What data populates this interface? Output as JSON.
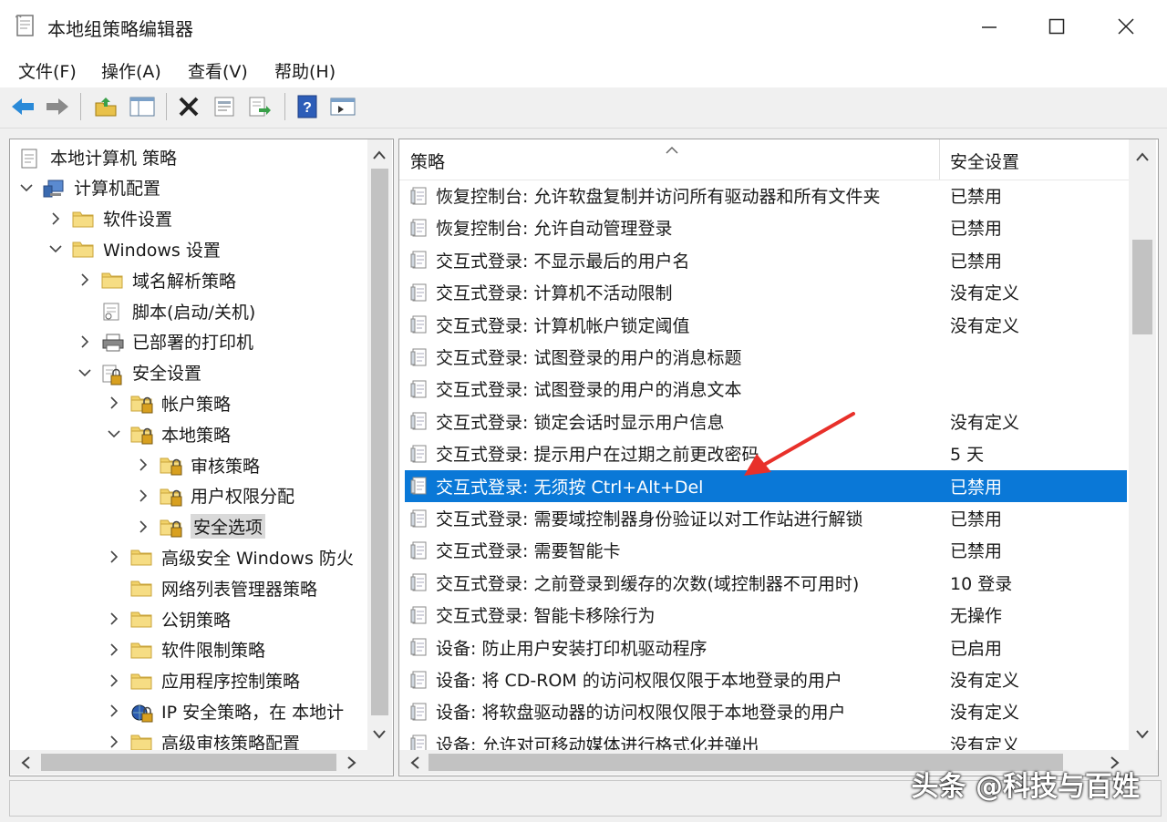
{
  "window": {
    "title": "本地组策略编辑器"
  },
  "menu": [
    "文件(F)",
    "操作(A)",
    "查看(V)",
    "帮助(H)"
  ],
  "tree": [
    {
      "label": "本地计算机 策略",
      "level": 0,
      "expand": "none",
      "icon": "policy-icon"
    },
    {
      "label": "计算机配置",
      "level": 0,
      "expand": "open",
      "icon": "computer-icon"
    },
    {
      "label": "软件设置",
      "level": 1,
      "expand": "closed",
      "icon": "folder-icon"
    },
    {
      "label": "Windows 设置",
      "level": 1,
      "expand": "open",
      "icon": "folder-icon"
    },
    {
      "label": "域名解析策略",
      "level": 2,
      "expand": "closed",
      "icon": "folder-icon"
    },
    {
      "label": "脚本(启动/关机)",
      "level": 2,
      "expand": "none",
      "icon": "script-icon"
    },
    {
      "label": "已部署的打印机",
      "level": 2,
      "expand": "closed",
      "icon": "printer-icon"
    },
    {
      "label": "安全设置",
      "level": 2,
      "expand": "open",
      "icon": "security-icon"
    },
    {
      "label": "帐户策略",
      "level": 3,
      "expand": "closed",
      "icon": "lock-folder-icon"
    },
    {
      "label": "本地策略",
      "level": 3,
      "expand": "open",
      "icon": "lock-folder-icon"
    },
    {
      "label": "审核策略",
      "level": 4,
      "expand": "closed",
      "icon": "lock-folder-icon"
    },
    {
      "label": "用户权限分配",
      "level": 4,
      "expand": "closed",
      "icon": "lock-folder-icon"
    },
    {
      "label": "安全选项",
      "level": 4,
      "expand": "closed",
      "icon": "lock-folder-icon",
      "selected": true
    },
    {
      "label": "高级安全 Windows 防火",
      "level": 3,
      "expand": "closed",
      "icon": "folder-icon"
    },
    {
      "label": "网络列表管理器策略",
      "level": 3,
      "expand": "none",
      "icon": "folder-icon"
    },
    {
      "label": "公钥策略",
      "level": 3,
      "expand": "closed",
      "icon": "folder-icon"
    },
    {
      "label": "软件限制策略",
      "level": 3,
      "expand": "closed",
      "icon": "folder-icon"
    },
    {
      "label": "应用程序控制策略",
      "level": 3,
      "expand": "closed",
      "icon": "folder-icon"
    },
    {
      "label": "IP 安全策略，在 本地计",
      "level": 3,
      "expand": "closed",
      "icon": "ip-security-icon"
    },
    {
      "label": "高级审核策略配置",
      "level": 3,
      "expand": "closed",
      "icon": "folder-icon"
    }
  ],
  "list": {
    "col_policy": "策略",
    "col_setting": "安全设置",
    "rows": [
      {
        "name": "恢复控制台: 允许软盘复制并访问所有驱动器和所有文件夹",
        "value": "已禁用"
      },
      {
        "name": "恢复控制台: 允许自动管理登录",
        "value": "已禁用"
      },
      {
        "name": "交互式登录: 不显示最后的用户名",
        "value": "已禁用"
      },
      {
        "name": "交互式登录: 计算机不活动限制",
        "value": "没有定义"
      },
      {
        "name": "交互式登录: 计算机帐户锁定阈值",
        "value": "没有定义"
      },
      {
        "name": "交互式登录: 试图登录的用户的消息标题",
        "value": ""
      },
      {
        "name": "交互式登录: 试图登录的用户的消息文本",
        "value": ""
      },
      {
        "name": "交互式登录: 锁定会话时显示用户信息",
        "value": "没有定义"
      },
      {
        "name": "交互式登录: 提示用户在过期之前更改密码",
        "value": "5 天"
      },
      {
        "name": "交互式登录: 无须按 Ctrl+Alt+Del",
        "value": "已禁用",
        "selected": true
      },
      {
        "name": "交互式登录: 需要域控制器身份验证以对工作站进行解锁",
        "value": "已禁用"
      },
      {
        "name": "交互式登录: 需要智能卡",
        "value": "已禁用"
      },
      {
        "name": "交互式登录: 之前登录到缓存的次数(域控制器不可用时)",
        "value": "10 登录"
      },
      {
        "name": "交互式登录: 智能卡移除行为",
        "value": "无操作"
      },
      {
        "name": "设备: 防止用户安装打印机驱动程序",
        "value": "已启用"
      },
      {
        "name": "设备: 将 CD-ROM 的访问权限仅限于本地登录的用户",
        "value": "没有定义"
      },
      {
        "name": "设备: 将软盘驱动器的访问权限仅限于本地登录的用户",
        "value": "没有定义"
      },
      {
        "name": "设备: 允许对可移动媒体进行格式化并弹出",
        "value": "没有定义"
      }
    ]
  },
  "watermark": "头条 @科技与百姓",
  "colors": {
    "selection": "#0a78d7",
    "arrow": "#e8302a"
  }
}
